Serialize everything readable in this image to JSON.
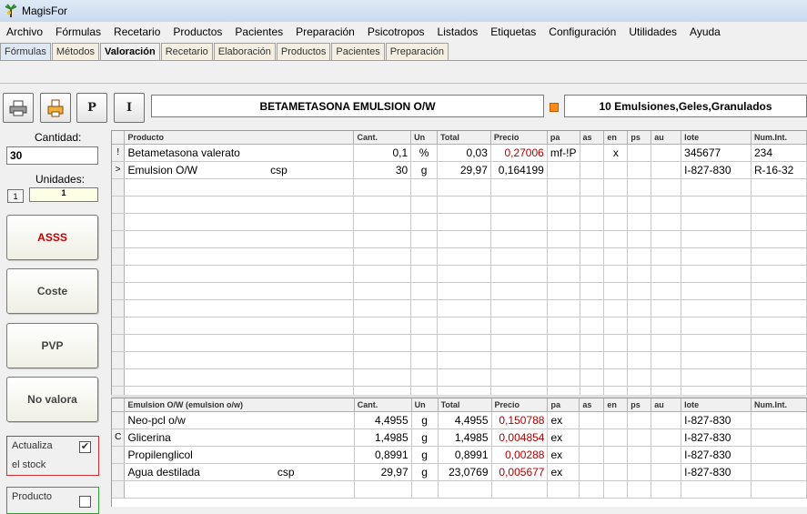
{
  "window": {
    "title": "MagisFor"
  },
  "menu": [
    "Archivo",
    "Fórmulas",
    "Recetario",
    "Productos",
    "Pacientes",
    "Preparación",
    "Psicotropos",
    "Listados",
    "Etiquetas",
    "Configuración",
    "Utilidades",
    "Ayuda"
  ],
  "tabs": [
    "Fórmulas",
    "Métodos",
    "Valoración",
    "Recetario",
    "Elaboración",
    "Productos",
    "Pacientes",
    "Preparación"
  ],
  "toolbar": {
    "btn_p": "P",
    "btn_i": "I"
  },
  "formula_title": "BETAMETASONA EMULSION O/W",
  "category": "10 Emulsiones,Geles,Granulados",
  "left": {
    "cantidad_label": "Cantidad:",
    "cantidad_value": "30",
    "unidades_label": "Unidades:",
    "unidades_btn": "1",
    "unidades_value": "1",
    "buttons": [
      "ASSS",
      "Coste",
      "PVP",
      "No valora"
    ],
    "actualiza": {
      "line1": "Actualiza",
      "line2": "el stock",
      "checked": "✔"
    },
    "producto": {
      "line1": "Producto"
    }
  },
  "top_grid": {
    "headers": [
      "Producto",
      "Cant.",
      "Un",
      "Total",
      "Precio",
      "pa",
      "as",
      "en",
      "ps",
      "au",
      "lote",
      "Num.Int."
    ],
    "rows": [
      {
        "ind": "!",
        "producto": "Betametasona valerato",
        "extra": "",
        "cant": "0,1",
        "un": "%",
        "total": "0,03",
        "precio": "0,27006",
        "pa": "mf-!P",
        "as": "",
        "en": "x",
        "ps": "",
        "au": "",
        "lote": "345677",
        "numint": "234"
      },
      {
        "ind": ">",
        "producto": "Emulsion O/W",
        "extra": "csp",
        "cant": "30",
        "un": "g",
        "total": "29,97",
        "precio": "0,164199",
        "pa": "",
        "as": "",
        "en": "",
        "ps": "",
        "au": "",
        "lote": "I-827-830",
        "numint": "R-16-32"
      }
    ]
  },
  "bottom_grid": {
    "headers": [
      "Emulsion O/W (emulsion o/w)",
      "Cant.",
      "Un",
      "Total",
      "Precio",
      "pa",
      "as",
      "en",
      "ps",
      "au",
      "lote",
      "Num.Int."
    ],
    "rows": [
      {
        "ind": "",
        "producto": "Neo-pcl o/w",
        "extra": "",
        "cant": "4,4955",
        "un": "g",
        "total": "4,4955",
        "precio": "0,150788",
        "pa": "ex",
        "lote": "I-827-830"
      },
      {
        "ind": "C",
        "producto": "Glicerina",
        "extra": "",
        "cant": "1,4985",
        "un": "g",
        "total": "1,4985",
        "precio": "0,004854",
        "pa": "ex",
        "lote": "I-827-830"
      },
      {
        "ind": "",
        "producto": "Propilenglicol",
        "extra": "",
        "cant": "0,8991",
        "un": "g",
        "total": "0,8991",
        "precio": "0,00288",
        "pa": "ex",
        "lote": "I-827-830"
      },
      {
        "ind": "",
        "producto": "Agua destilada",
        "extra": "csp",
        "cant": "29,97",
        "un": "g",
        "total": "23,0769",
        "precio": "0,005677",
        "pa": "ex",
        "lote": "I-827-830"
      }
    ]
  },
  "colors": {
    "price_red": "#b00000",
    "accent_orange": "#ff8c1a",
    "asss_red": "#c00000"
  }
}
